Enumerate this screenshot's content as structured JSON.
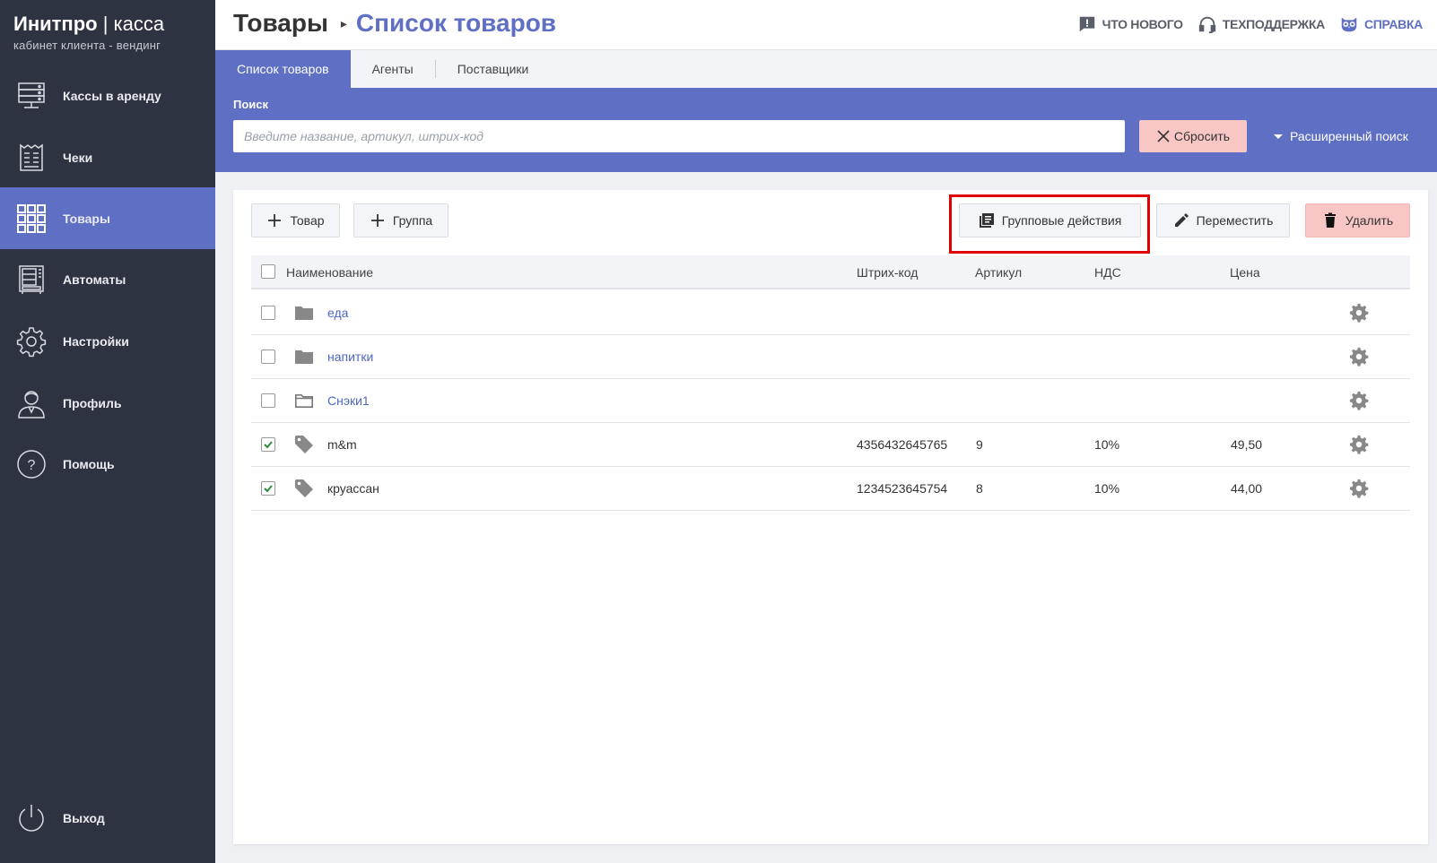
{
  "brand": {
    "title_bold": "Инитпро",
    "title_sep": " | ",
    "title_rest": "касса",
    "subtitle": "кабинет клиента - вендинг"
  },
  "sidebar": {
    "items": [
      {
        "label": "Кассы в аренду",
        "icon": "server-icon"
      },
      {
        "label": "Чеки",
        "icon": "receipt-icon"
      },
      {
        "label": "Товары",
        "icon": "grid-icon",
        "active": true
      },
      {
        "label": "Автоматы",
        "icon": "vending-machine-icon"
      },
      {
        "label": "Настройки",
        "icon": "gear-icon"
      },
      {
        "label": "Профиль",
        "icon": "user-icon"
      },
      {
        "label": "Помощь",
        "icon": "help-icon"
      }
    ],
    "logout": {
      "label": "Выход",
      "icon": "power-icon"
    }
  },
  "header": {
    "title": "Товары",
    "separator": "▸",
    "subtitle": "Список товаров",
    "links": [
      {
        "label": "что нового",
        "icon": "comment-alert-icon"
      },
      {
        "label": "техподдержка",
        "icon": "headset-icon"
      },
      {
        "label": "справка",
        "icon": "owl-icon"
      }
    ]
  },
  "tabs": [
    {
      "label": "Список товаров",
      "active": true
    },
    {
      "label": "Агенты"
    },
    {
      "label": "Поставщики"
    }
  ],
  "search": {
    "label": "Поиск",
    "placeholder": "Введите название, артикул, штрих-код",
    "value": "",
    "reset_label": "Сбросить",
    "advanced_label": "Расширенный поиск"
  },
  "toolbar": {
    "add_item": "Товар",
    "add_group": "Группа",
    "group_actions": "Групповые действия",
    "move": "Переместить",
    "delete": "Удалить"
  },
  "table": {
    "columns": {
      "name": "Наименование",
      "barcode": "Штрих-код",
      "article": "Артикул",
      "vat": "НДС",
      "price": "Цена"
    },
    "rows": [
      {
        "type": "folder",
        "name": "еда",
        "barcode": "",
        "article": "",
        "vat": "",
        "price": "",
        "checked": false
      },
      {
        "type": "folder",
        "name": "напитки",
        "barcode": "",
        "article": "",
        "vat": "",
        "price": "",
        "checked": false
      },
      {
        "type": "folder-outline",
        "name": "Снэки1",
        "barcode": "",
        "article": "",
        "vat": "",
        "price": "",
        "checked": false
      },
      {
        "type": "product",
        "name": "m&m",
        "barcode": "4356432645765",
        "article": "9",
        "vat": "10%",
        "price": "49,50",
        "checked": true
      },
      {
        "type": "product",
        "name": "круассан",
        "barcode": "1234523645754",
        "article": "8",
        "vat": "10%",
        "price": "44,00",
        "checked": true
      }
    ]
  },
  "colors": {
    "accent": "#5f6fc3",
    "sidebar": "#2e3341",
    "danger_bg": "#f9c6c6",
    "highlight": "#e00000",
    "check": "#2e8b3a"
  }
}
